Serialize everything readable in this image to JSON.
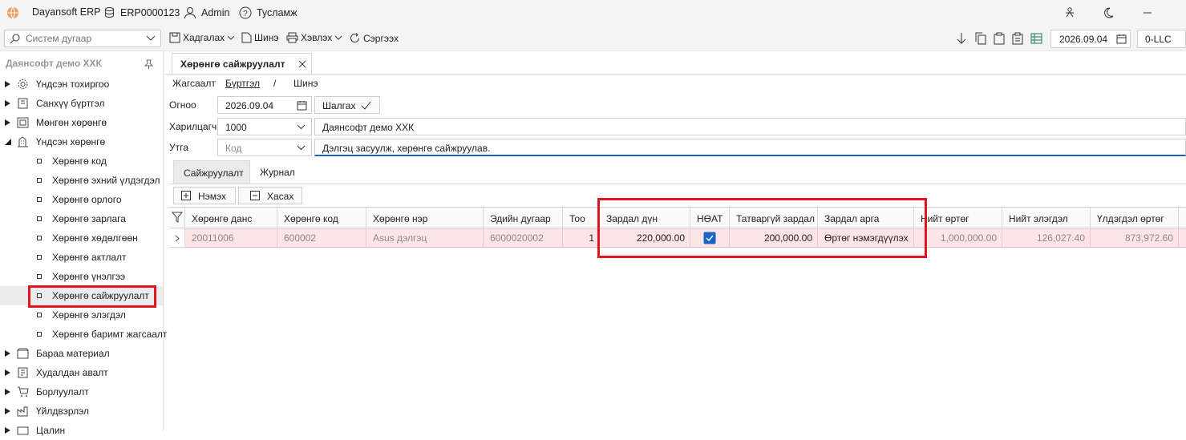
{
  "app": {
    "name": "Dayansoft ERP",
    "db": "ERP0000123",
    "user": "Admin",
    "help": "Тусламж"
  },
  "toolbar": {
    "search_placeholder": "Систем дугаар",
    "save": "Хадгалах",
    "new": "Шинэ",
    "print": "Хэвлэх",
    "refresh": "Сэргээх",
    "date": "2026.09.04",
    "company_code": "0-LLC"
  },
  "sidebar": {
    "title": "Даянсофт демо ХХК",
    "items": [
      {
        "label": "Үндсэн тохиргоо",
        "icon": "gear-icon"
      },
      {
        "label": "Санхүү бүртгэл",
        "icon": "ledger-icon"
      },
      {
        "label": "Мөнгөн хөрөнгө",
        "icon": "cash-icon"
      },
      {
        "label": "Үндсэн хөрөнгө",
        "icon": "building-icon"
      }
    ],
    "sub_items": [
      "Хөрөнгө код",
      "Хөрөнгө эхний үлдэгдэл",
      "Хөрөнгө орлого",
      "Хөрөнгө зарлага",
      "Хөрөнгө хөдөлгөөн",
      "Хөрөнгө актлалт",
      "Хөрөнгө үнэлгээ",
      "Хөрөнгө сайжруулалт",
      "Хөрөнгө элэгдэл",
      "Хөрөнгө баримт жагсаалт"
    ],
    "items_after": [
      {
        "label": "Бараа материал",
        "icon": "box-icon"
      },
      {
        "label": "Худалдан авалт",
        "icon": "purchase-icon"
      },
      {
        "label": "Борлуулалт",
        "icon": "cart-icon"
      },
      {
        "label": "Үйлдвэрлэл",
        "icon": "factory-icon"
      },
      {
        "label": "Цалин",
        "icon": "salary-icon"
      }
    ]
  },
  "document": {
    "tab_title": "Хөрөнгө сайжруулалт",
    "breadcrumb": [
      "Жагсаалт",
      "Бүртгэл",
      "/",
      "Шинэ"
    ],
    "form": {
      "date_label": "Огноо",
      "date_value": "2026.09.04",
      "check_button": "Шалгах",
      "partner_label": "Харилцагч",
      "partner_code": "1000",
      "partner_name": "Даянсофт демо ХХК",
      "note_label": "Утга",
      "note_placeholder": "Код",
      "note_value": "Дэлгэц засуулж, хөрөнгө сайжруулав."
    },
    "inner_tabs": [
      "Сайжруулалт",
      "Журнал"
    ],
    "grid_actions": {
      "add": "Нэмэх",
      "remove": "Хасах"
    },
    "grid": {
      "columns": [
        "Хөрөнгө данс",
        "Хөрөнгө код",
        "Хөрөнгө нэр",
        "Эдийн дугаар",
        "Тоо",
        "Зардал дүн",
        "НӨАТ",
        "Татваргүй зардал",
        "Зардал арга",
        "Нийт өртөг",
        "Нийт элэгдэл",
        "Үлдэгдэл өртөг"
      ],
      "rows": [
        {
          "account": "20011006",
          "code": "600002",
          "name": "Asus дэлгэц",
          "serial": "6000020002",
          "qty": "1",
          "cost": "220,000.00",
          "vat": true,
          "cost_no_tax": "200,000.00",
          "method": "Өртөг нэмэгдүүлэх",
          "total_cost": "1,000,000.00",
          "total_depr": "126,027.40",
          "remaining": "873,972.60"
        }
      ]
    }
  },
  "colors": {
    "highlight": "#e2141d",
    "row_bg": "#fde4e7",
    "checkbox": "#1766c4"
  }
}
